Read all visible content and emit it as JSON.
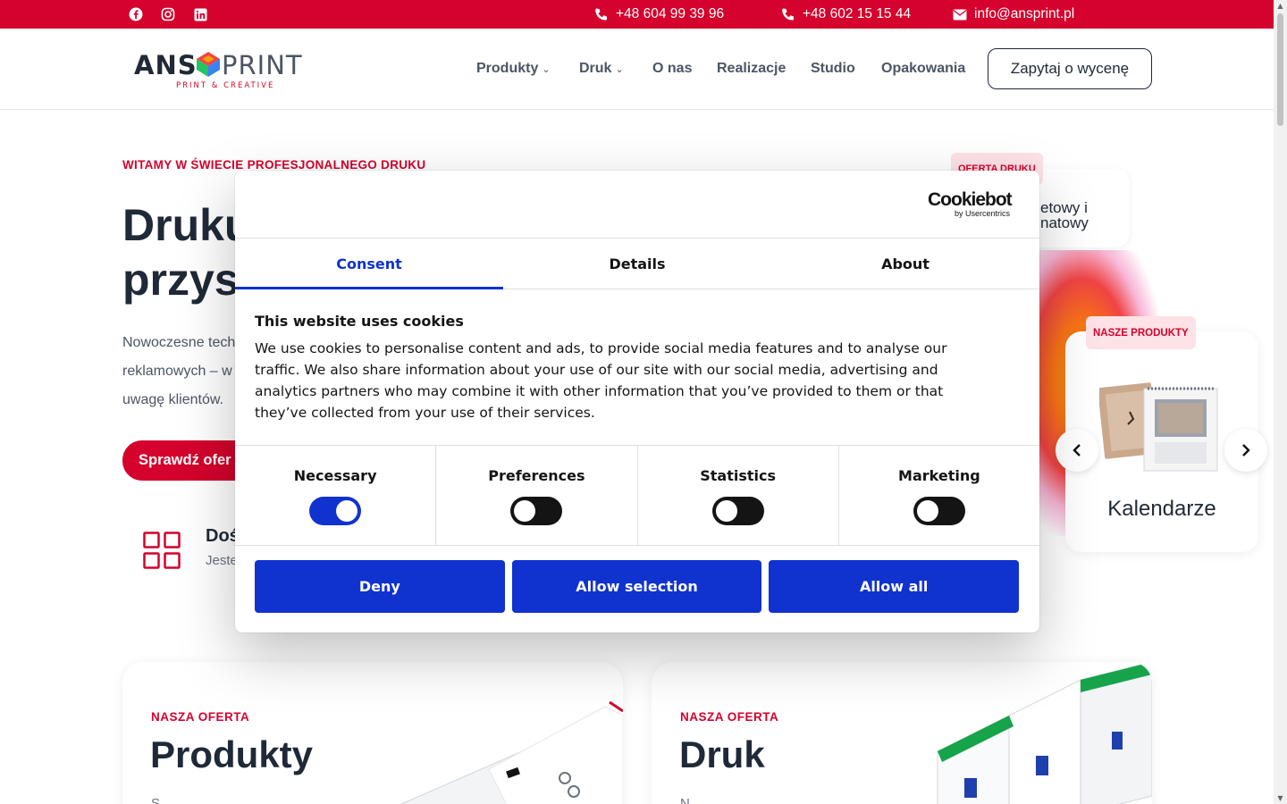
{
  "topbar": {
    "social": [
      "facebook-icon",
      "instagram-icon",
      "linkedin-icon"
    ],
    "phone1": "+48 604 99 39 96",
    "phone2": "+48 602 15 15 44",
    "email": "info@ansprint.pl"
  },
  "header": {
    "logo_left": "ANS",
    "logo_right": "PRINT",
    "logo_tagline": "PRINT & CREATIVE",
    "nav": [
      {
        "label": "Produkty",
        "dropdown": true
      },
      {
        "label": "Druk",
        "dropdown": true
      },
      {
        "label": "O nas",
        "dropdown": false
      },
      {
        "label": "Realizacje",
        "dropdown": false
      },
      {
        "label": "Studio",
        "dropdown": false
      },
      {
        "label": "Opakowania",
        "dropdown": false
      }
    ],
    "quote_button": "Zapytaj o wycenę"
  },
  "hero": {
    "eyebrow": "WITAMY W ŚWIECIE PROFESJONALNEGO DRUKU",
    "title_line1": "Druku",
    "title_line2": "przysz",
    "desc_line1": "Nowoczesne tech",
    "desc_line2": "reklamowych – w",
    "desc_line3": "uwagę klientów.",
    "cta": "Sprawdź ofer",
    "feature_title": "Doś",
    "feature_sub": "Jeste"
  },
  "side_cards": {
    "top_badge": "OFERTA DRUKU",
    "top_text_line1": "etowy i",
    "top_text_line2": "natowy",
    "product_badge": "NASZE PRODUKTY",
    "product_title": "Kalendarze",
    "prev_icon": "chevron-left-icon",
    "next_icon": "chevron-right-icon"
  },
  "offers": [
    {
      "eyebrow": "NASZA OFERTA",
      "title": "Produkty",
      "desc": "S"
    },
    {
      "eyebrow": "NASZA OFERTA",
      "title": "Druk",
      "desc": "N"
    }
  ],
  "cookie": {
    "brand": "Cookiebot",
    "brand_sub": "by Usercentrics",
    "tabs": [
      "Consent",
      "Details",
      "About"
    ],
    "active_tab": "Consent",
    "heading": "This website uses cookies",
    "body": "We use cookies to personalise content and ads, to provide social media features and to analyse our traffic. We also share information about your use of our site with our social media, advertising and analytics partners who may combine it with other information that you’ve provided to them or that they’ve collected from your use of their services.",
    "toggles": [
      {
        "label": "Necessary",
        "on": true
      },
      {
        "label": "Preferences",
        "on": false
      },
      {
        "label": "Statistics",
        "on": false
      },
      {
        "label": "Marketing",
        "on": false
      }
    ],
    "buttons": [
      "Deny",
      "Allow selection",
      "Allow all"
    ]
  },
  "colors": {
    "brand_red": "#d4022c",
    "cookie_blue": "#1032cf",
    "text_dark": "#1f2937"
  }
}
